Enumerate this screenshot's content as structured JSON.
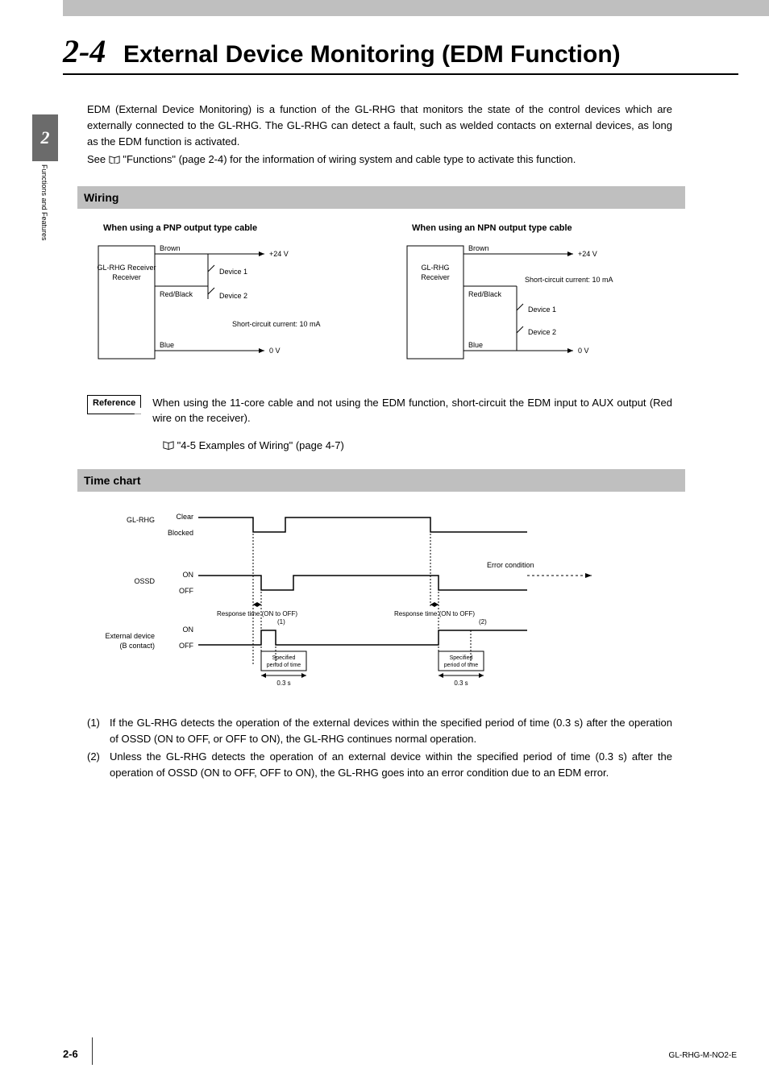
{
  "chapter_tab": "2",
  "side_label": "Functions and Features",
  "heading": {
    "number": "2-4",
    "title": "External Device Monitoring (EDM Function)"
  },
  "intro": {
    "p1": "EDM (External Device Monitoring) is a function of the GL-RHG that monitors the state of the control devices which are externally connected to the GL-RHG. The GL-RHG can detect a fault, such as welded contacts on external devices, as long as the EDM function is activated.",
    "p2_prefix": "See ",
    "p2_link": "\"Functions\" (page 2-4)",
    "p2_suffix": " for the information of wiring system and cable type to activate this function."
  },
  "wiring": {
    "heading": "Wiring",
    "pnp": {
      "title": "When using a PNP output type cable",
      "box": "GL-RHG\nReceiver",
      "brown": "Brown",
      "redblack": "Red/Black",
      "blue": "Blue",
      "v24": "+24 V",
      "d1": "Device 1",
      "d2": "Device 2",
      "sc": "Short-circuit current: 10 mA",
      "v0": "0 V"
    },
    "npn": {
      "title": "When using an NPN output type cable",
      "box": "GL-RHG\nReceiver",
      "brown": "Brown",
      "redblack": "Red/Black",
      "blue": "Blue",
      "v24": "+24 V",
      "sc": "Short-circuit current: 10 mA",
      "d1": "Device 1",
      "d2": "Device 2",
      "v0": "0 V"
    }
  },
  "reference": {
    "label": "Reference",
    "text": "When using the 11-core cable and not using the EDM function, short-circuit the EDM input to AUX output (Red wire on the receiver).",
    "link": "\"4-5 Examples of Wiring\" (page 4-7)"
  },
  "timechart": {
    "heading": "Time chart",
    "rows": {
      "glrhg": "GL-RHG",
      "ossd": "OSSD",
      "ext": "External device\n(B contact)"
    },
    "states": {
      "clear": "Clear",
      "blocked": "Blocked",
      "on": "ON",
      "off": "OFF"
    },
    "labels": {
      "resp1": "Response time (ON to OFF)",
      "resp2": "Response time (ON to OFF)",
      "spec": "Specified\nperiod of time",
      "t03": "0.3 s",
      "err": "Error condition",
      "n1": "(1)",
      "n2": "(2)"
    }
  },
  "notes": {
    "n1_num": "(1)",
    "n1": "If the GL-RHG detects the operation of the external devices within the specified period of time (0.3 s) after the operation of OSSD (ON to OFF, or OFF to ON), the GL-RHG continues normal operation.",
    "n2_num": "(2)",
    "n2": "Unless the GL-RHG detects the operation of an external device within the specified period of time (0.3 s) after the operation of OSSD (ON to OFF, OFF to ON), the GL-RHG goes into an error condition due to an EDM error."
  },
  "footer": {
    "page": "2-6",
    "doc": "GL-RHG-M-NO2-E"
  }
}
